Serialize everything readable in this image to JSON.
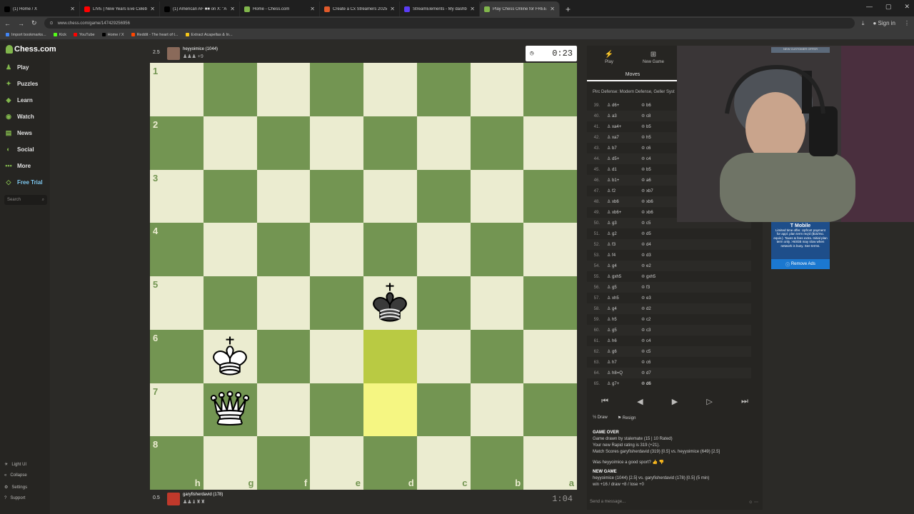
{
  "browser": {
    "tabs": [
      {
        "title": "(1) Home / X",
        "color": "#000000"
      },
      {
        "title": "LIVE | New Years Eve Celebratic",
        "color": "#ff0000"
      },
      {
        "title": "(1) American AF ■■ on X: \"A mo",
        "color": "#000000"
      },
      {
        "title": "Home - Chess.com",
        "color": "#81b64c"
      },
      {
        "title": "Create a Cx Streamers 2025 Tie",
        "color": "#e05a2b"
      },
      {
        "title": "StreamElements - My dashboa",
        "color": "#5b3df5"
      },
      {
        "title": "Play Chess Online for FREE",
        "color": "#81b64c",
        "active": true
      }
    ],
    "url": "www.chess.com/game/147429256956",
    "sign_in": "Sign in",
    "bookmarks": [
      {
        "label": "Import bookmarks...",
        "color": "#4285f4"
      },
      {
        "label": "Kick",
        "color": "#53fc18"
      },
      {
        "label": "YouTube",
        "color": "#ff0000"
      },
      {
        "label": "Home / X",
        "color": "#000000"
      },
      {
        "label": "Reddit - The heart of t...",
        "color": "#ff4500"
      },
      {
        "label": "Extract Acapellas & In...",
        "color": "#f5c518"
      }
    ]
  },
  "sidebar": {
    "logo": "Chess.com",
    "items": [
      {
        "label": "Play",
        "icon": "play-icon"
      },
      {
        "label": "Puzzles",
        "icon": "puzzle-icon"
      },
      {
        "label": "Learn",
        "icon": "learn-icon"
      },
      {
        "label": "Watch",
        "icon": "watch-icon"
      },
      {
        "label": "News",
        "icon": "news-icon"
      },
      {
        "label": "Social",
        "icon": "social-icon"
      },
      {
        "label": "More",
        "icon": "more-icon"
      },
      {
        "label": "Free Trial",
        "icon": "diamond-icon"
      }
    ],
    "search_placeholder": "Search",
    "bottom": [
      "Light UI",
      "Collapse",
      "Settings",
      "Support"
    ]
  },
  "top_player": {
    "score": "2.5",
    "name": "heyyoimice (1044)",
    "captured": "+9",
    "clock": "0:23"
  },
  "bottom_player": {
    "score": "0.5",
    "name": "garyfisherdavid (178)",
    "clock": "1:04"
  },
  "board": {
    "ranks": [
      "1",
      "2",
      "3",
      "4",
      "5",
      "6",
      "7",
      "8"
    ],
    "files": [
      "h",
      "g",
      "f",
      "e",
      "d",
      "c",
      "b",
      "a"
    ],
    "pieces": [
      {
        "piece": "black-king",
        "file": "d",
        "rank": "5"
      },
      {
        "piece": "white-king",
        "file": "g",
        "rank": "6"
      },
      {
        "piece": "white-queen",
        "file": "g",
        "rank": "7"
      }
    ],
    "highlighted": [
      {
        "file": "d",
        "rank": "6"
      },
      {
        "file": "d",
        "rank": "7"
      }
    ]
  },
  "panel": {
    "tabs": [
      {
        "label": "Play",
        "icon": "bolt-icon"
      },
      {
        "label": "New Game",
        "icon": "plus-icon"
      }
    ],
    "moves_label": "Moves",
    "opening": "Pirc Defense: Modern Defense, Geller Syst",
    "moves": [
      {
        "n": "39.",
        "w": "d6+",
        "b": "b6"
      },
      {
        "n": "40.",
        "w": "a3",
        "b": "c8"
      },
      {
        "n": "41.",
        "w": "xa4+",
        "b": "b5"
      },
      {
        "n": "42.",
        "w": "xa7",
        "b": "h5"
      },
      {
        "n": "43.",
        "w": "b7",
        "b": "c6"
      },
      {
        "n": "44.",
        "w": "d5+",
        "b": "c4"
      },
      {
        "n": "45.",
        "w": "d1",
        "b": "b5"
      },
      {
        "n": "46.",
        "w": "b1+",
        "b": "a6"
      },
      {
        "n": "47.",
        "w": "f2",
        "b": "xb7"
      },
      {
        "n": "48.",
        "w": "xb6",
        "b": "xb6"
      },
      {
        "n": "49.",
        "w": "xb6+",
        "b": "xb6"
      },
      {
        "n": "50.",
        "w": "g3",
        "b": "c5"
      },
      {
        "n": "51.",
        "w": "g2",
        "b": "d5"
      },
      {
        "n": "52.",
        "w": "f3",
        "b": "d4"
      },
      {
        "n": "53.",
        "w": "f4",
        "b": "d3"
      },
      {
        "n": "54.",
        "w": "g4",
        "b": "e2"
      },
      {
        "n": "55.",
        "w": "gxh5",
        "b": "gxh5"
      },
      {
        "n": "56.",
        "w": "g5",
        "b": "f3"
      },
      {
        "n": "57.",
        "w": "xh5",
        "b": "e3"
      },
      {
        "n": "58.",
        "w": "g4",
        "b": "d2"
      },
      {
        "n": "59.",
        "w": "h5",
        "b": "c2"
      },
      {
        "n": "60.",
        "w": "g5",
        "b": "c3"
      },
      {
        "n": "61.",
        "w": "h6",
        "b": "c4"
      },
      {
        "n": "62.",
        "w": "g6",
        "b": "c5"
      },
      {
        "n": "63.",
        "w": "h7",
        "b": "c6"
      },
      {
        "n": "64.",
        "w": "h8=Q",
        "b": "d7"
      },
      {
        "n": "65.",
        "w": "g7+",
        "b": "d6"
      }
    ],
    "draw_label": "Draw",
    "resign_label": "Resign",
    "game_over": {
      "header": "GAME OVER",
      "line1": "Game drawn by stalemate (15 | 10 Rated)",
      "line2": "Your new Rapid rating is 319 (+21).",
      "line3": "Match Scores garyfisherdavid (319) [0.5] vs. heyyoimice (649) [2.5]",
      "question": "Was heyyoimice a good sport?",
      "new_game": "NEW GAME",
      "line4": "heyyoimice (1044) [2.5] vs. garyfisherdavid (178) [0.5] (5 min)",
      "line5": "win +16 / draw +8 / lose +0"
    },
    "message_placeholder": "Send a message..."
  },
  "ad": {
    "brand": "T Mobile",
    "text": "Limited time offer. Upfront payment for appl. plan term req'd ($15/mo. equiv.). Taxes & fees extra. Initial plan term only. >50GB may slow when network is busy. See terms.",
    "remove": "Remove Ads",
    "offer": "NEW CUSTOMER OFFER"
  }
}
